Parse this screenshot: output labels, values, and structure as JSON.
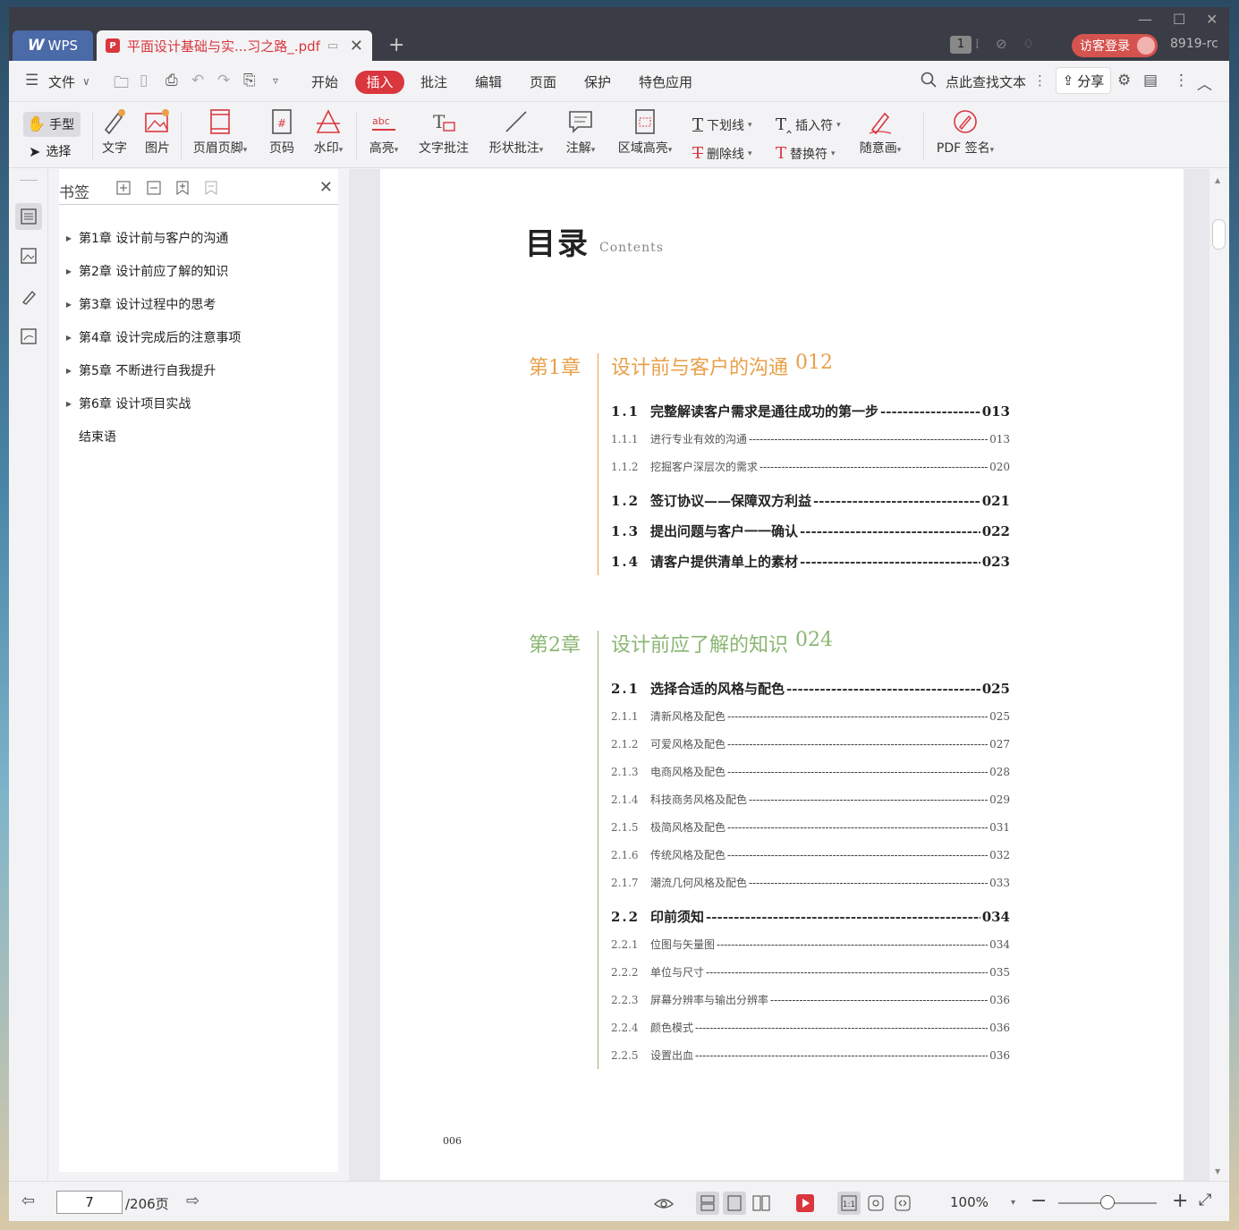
{
  "app": {
    "brand": "WPS",
    "doc_tab": "平面设计基础与实...习之路_.pdf",
    "page_badge": "1",
    "login": "访客登录",
    "user": "8919-rc"
  },
  "menu": {
    "file": "文件",
    "tabs": [
      "开始",
      "插入",
      "批注",
      "编辑",
      "页面",
      "保护",
      "特色应用"
    ],
    "active_tab": "插入",
    "search": "点此查找文本",
    "share": "分享"
  },
  "ribbon": {
    "hand": "手型",
    "select": "选择",
    "text": "文字",
    "image": "图片",
    "header_footer": "页眉页脚",
    "page_num": "页码",
    "watermark": "水印",
    "highlight": "高亮",
    "text_note": "文字批注",
    "shape_note": "形状批注",
    "annotate": "注解",
    "area_highlight": "区域高亮",
    "underline": "下划线",
    "strikethrough": "删除线",
    "insert_mark": "插入符",
    "replace_mark": "替换符",
    "freehand": "随意画",
    "pdf_sign": "PDF 签名"
  },
  "bookmarks": {
    "title": "书签",
    "items": [
      "第1章 设计前与客户的沟通",
      "第2章 设计前应了解的知识",
      "第3章 设计过程中的思考",
      "第4章 设计完成后的注意事项",
      "第5章 不断进行自我提升",
      "第6章 设计项目实战",
      "结束语"
    ]
  },
  "page": {
    "title": "目录",
    "subtitle": "Contents",
    "page_number": "006",
    "chapters": [
      {
        "label": "第1章",
        "title": "设计前与客户的沟通",
        "page": "012",
        "color": "#e8a04a",
        "entries": [
          {
            "level": 1,
            "num": "1.1",
            "text": "完整解读客户需求是通往成功的第一步",
            "page": "013"
          },
          {
            "level": 2,
            "num": "1.1.1",
            "text": "进行专业有效的沟通",
            "page": "013"
          },
          {
            "level": 2,
            "num": "1.1.2",
            "text": "挖掘客户深层次的需求",
            "page": "020"
          },
          {
            "level": 1,
            "num": "1.2",
            "text": "签订协议——保障双方利益",
            "page": "021"
          },
          {
            "level": 1,
            "num": "1.3",
            "text": "提出问题与客户一一确认",
            "page": "022"
          },
          {
            "level": 1,
            "num": "1.4",
            "text": "请客户提供清单上的素材",
            "page": "023"
          }
        ]
      },
      {
        "label": "第2章",
        "title": "设计前应了解的知识",
        "page": "024",
        "color": "#8ab672",
        "entries": [
          {
            "level": 1,
            "num": "2.1",
            "text": "选择合适的风格与配色",
            "page": "025"
          },
          {
            "level": 2,
            "num": "2.1.1",
            "text": "清新风格及配色",
            "page": "025"
          },
          {
            "level": 2,
            "num": "2.1.2",
            "text": "可爱风格及配色",
            "page": "027"
          },
          {
            "level": 2,
            "num": "2.1.3",
            "text": "电商风格及配色",
            "page": "028"
          },
          {
            "level": 2,
            "num": "2.1.4",
            "text": "科技商务风格及配色",
            "page": "029"
          },
          {
            "level": 2,
            "num": "2.1.5",
            "text": "极简风格及配色",
            "page": "031"
          },
          {
            "level": 2,
            "num": "2.1.6",
            "text": "传统风格及配色",
            "page": "032"
          },
          {
            "level": 2,
            "num": "2.1.7",
            "text": "潮流几何风格及配色",
            "page": "033"
          },
          {
            "level": 1,
            "num": "2.2",
            "text": "印前须知",
            "page": "034"
          },
          {
            "level": 2,
            "num": "2.2.1",
            "text": "位图与矢量图",
            "page": "034"
          },
          {
            "level": 2,
            "num": "2.2.2",
            "text": "单位与尺寸",
            "page": "035"
          },
          {
            "level": 2,
            "num": "2.2.3",
            "text": "屏幕分辨率与输出分辨率",
            "page": "036"
          },
          {
            "level": 2,
            "num": "2.2.4",
            "text": "颜色模式",
            "page": "036"
          },
          {
            "level": 2,
            "num": "2.2.5",
            "text": "设置出血",
            "page": "036"
          }
        ]
      }
    ]
  },
  "status": {
    "current_page": "7",
    "total_pages": "/206页",
    "zoom": "100%"
  },
  "colors": {
    "accent": "#d9363e",
    "titlebar": "#3a3c46"
  }
}
